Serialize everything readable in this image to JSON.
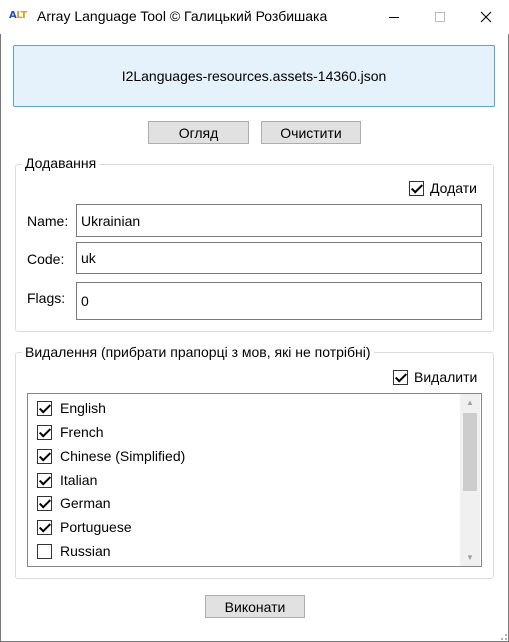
{
  "window": {
    "title": "Array Language Tool © Галицький Розбишака",
    "icon_text_a": "A",
    "icon_text_lt": "LT"
  },
  "file": {
    "name": "I2Languages-resources.assets-14360.json"
  },
  "buttons": {
    "browse": "Огляд",
    "clear": "Очистити",
    "run": "Виконати"
  },
  "add_group": {
    "title": "Додавання",
    "enable_label": "Додати",
    "enable_checked": true,
    "name_label": "Name:",
    "name_value": "Ukrainian",
    "code_label": "Code:",
    "code_value": "uk",
    "flags_label": "Flags:",
    "flags_value": "0"
  },
  "delete_group": {
    "title": "Видалення (прибрати прапорці з мов, які не потрібні)",
    "enable_label": "Видалити",
    "enable_checked": true,
    "languages": [
      {
        "name": "English",
        "checked": true
      },
      {
        "name": "French",
        "checked": true
      },
      {
        "name": "Chinese (Simplified)",
        "checked": true
      },
      {
        "name": "Italian",
        "checked": true
      },
      {
        "name": "German",
        "checked": true
      },
      {
        "name": "Portuguese",
        "checked": true
      },
      {
        "name": "Russian",
        "checked": false
      }
    ]
  },
  "icons": {
    "minimize": "minimize-icon",
    "maximize": "maximize-icon",
    "close": "close-icon",
    "scroll_up": "chevron-up-icon",
    "scroll_down": "chevron-down-icon",
    "check": "checkmark-icon"
  }
}
